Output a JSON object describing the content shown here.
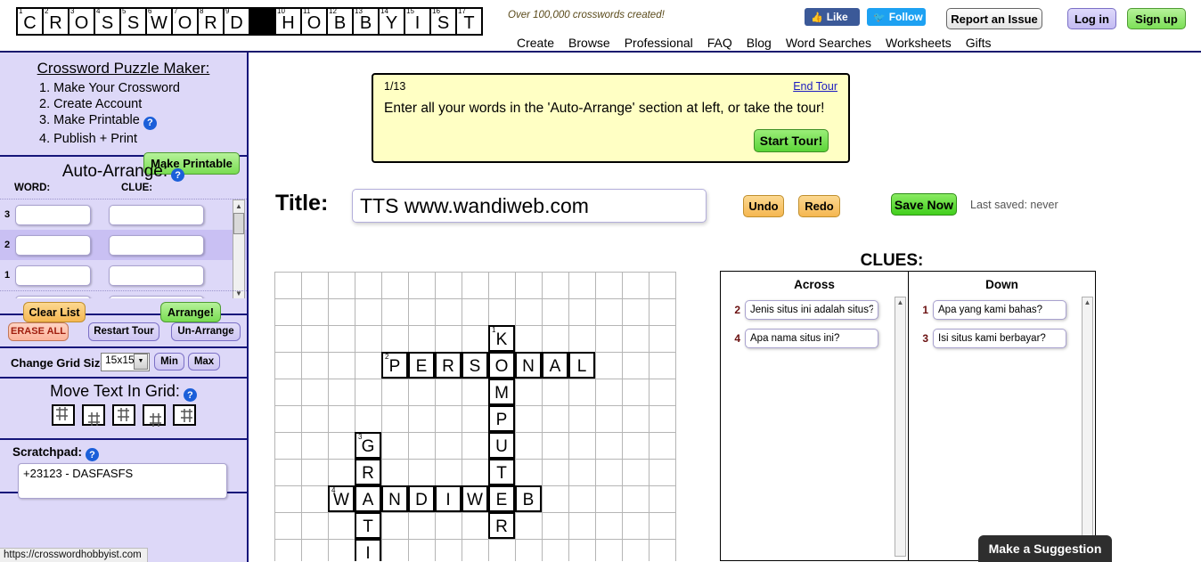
{
  "header": {
    "logo_letters": [
      {
        "n": "1",
        "l": "C"
      },
      {
        "n": "2",
        "l": "R"
      },
      {
        "n": "3",
        "l": "O"
      },
      {
        "n": "4",
        "l": "S"
      },
      {
        "n": "5",
        "l": "S"
      },
      {
        "n": "6",
        "l": "W"
      },
      {
        "n": "7",
        "l": "O"
      },
      {
        "n": "8",
        "l": "R"
      },
      {
        "n": "9",
        "l": "D"
      },
      {
        "n": "",
        "l": "",
        "black": true
      },
      {
        "n": "10",
        "l": "H"
      },
      {
        "n": "11",
        "l": "O"
      },
      {
        "n": "12",
        "l": "B"
      },
      {
        "n": "13",
        "l": "B"
      },
      {
        "n": "14",
        "l": "Y"
      },
      {
        "n": "15",
        "l": "I"
      },
      {
        "n": "16",
        "l": "S"
      },
      {
        "n": "17",
        "l": "T"
      }
    ],
    "tagline": "Over 100,000 crosswords created!",
    "facebook_label": "Like",
    "twitter_label": "Follow",
    "report_label": "Report an Issue",
    "login_label": "Log in",
    "signup_label": "Sign up",
    "nav": [
      "Create",
      "Browse",
      "Professional",
      "FAQ",
      "Blog",
      "Word Searches",
      "Worksheets",
      "Gifts"
    ]
  },
  "sidebar": {
    "maker_title": "Crossword Puzzle Maker:",
    "steps": [
      {
        "text": "1. Make Your Crossword",
        "help": false
      },
      {
        "text": "2. Create Account",
        "help": false
      },
      {
        "text": "3. Make Printable",
        "help": true
      },
      {
        "text": "4. Publish + Print",
        "help": false
      }
    ],
    "make_printable_label": "Make Printable",
    "auto_arrange_title": "Auto-Arrange:",
    "col_word": "WORD:",
    "col_clue": "CLUE:",
    "word_rows": [
      {
        "index": "1",
        "word": "",
        "clue": ""
      },
      {
        "index": "2",
        "word": "",
        "clue": ""
      },
      {
        "index": "3",
        "word": "",
        "clue": ""
      }
    ],
    "clear_list_label": "Clear List",
    "arrange_label": "Arrange!",
    "erase_all_label": "ERASE ALL",
    "restart_tour_label": "Restart Tour",
    "un_arrange_label": "Un-Arrange",
    "grid_size_label": "Change Grid Size:",
    "grid_size_value": "15x15",
    "min_label": "Min",
    "max_label": "Max",
    "move_text_title": "Move Text In Grid:",
    "scratchpad_label": "Scratchpad:",
    "scratchpad_value": "+23123 - DASFASFS",
    "status_url": "https://crosswordhobbyist.com"
  },
  "tour": {
    "counter": "1/13",
    "end_label": "End Tour",
    "message": "Enter all your words in the 'Auto-Arrange' section at left, or take the tour!",
    "start_label": "Start Tour!"
  },
  "toolbar": {
    "title_label": "Title:",
    "title_value": "TTS www.wandiweb.com",
    "undo_label": "Undo",
    "redo_label": "Redo",
    "save_label": "Save Now",
    "last_saved": "Last saved: never"
  },
  "grid": {
    "cols": 15,
    "rows": 11,
    "cell": 30,
    "filled": [
      {
        "r": 2,
        "c": 8,
        "l": "K",
        "n": "1"
      },
      {
        "r": 3,
        "c": 4,
        "l": "P",
        "n": "2"
      },
      {
        "r": 3,
        "c": 5,
        "l": "E",
        "n": ""
      },
      {
        "r": 3,
        "c": 6,
        "l": "R",
        "n": ""
      },
      {
        "r": 3,
        "c": 7,
        "l": "S",
        "n": ""
      },
      {
        "r": 3,
        "c": 8,
        "l": "O",
        "n": ""
      },
      {
        "r": 3,
        "c": 9,
        "l": "N",
        "n": ""
      },
      {
        "r": 3,
        "c": 10,
        "l": "A",
        "n": ""
      },
      {
        "r": 3,
        "c": 11,
        "l": "L",
        "n": ""
      },
      {
        "r": 4,
        "c": 8,
        "l": "M",
        "n": ""
      },
      {
        "r": 5,
        "c": 8,
        "l": "P",
        "n": ""
      },
      {
        "r": 6,
        "c": 3,
        "l": "G",
        "n": "3"
      },
      {
        "r": 6,
        "c": 8,
        "l": "U",
        "n": ""
      },
      {
        "r": 7,
        "c": 3,
        "l": "R",
        "n": ""
      },
      {
        "r": 7,
        "c": 8,
        "l": "T",
        "n": ""
      },
      {
        "r": 8,
        "c": 2,
        "l": "W",
        "n": "4"
      },
      {
        "r": 8,
        "c": 3,
        "l": "A",
        "n": ""
      },
      {
        "r": 8,
        "c": 4,
        "l": "N",
        "n": ""
      },
      {
        "r": 8,
        "c": 5,
        "l": "D",
        "n": ""
      },
      {
        "r": 8,
        "c": 6,
        "l": "I",
        "n": ""
      },
      {
        "r": 8,
        "c": 7,
        "l": "W",
        "n": ""
      },
      {
        "r": 8,
        "c": 8,
        "l": "E",
        "n": ""
      },
      {
        "r": 8,
        "c": 9,
        "l": "B",
        "n": ""
      },
      {
        "r": 9,
        "c": 3,
        "l": "T",
        "n": ""
      },
      {
        "r": 9,
        "c": 8,
        "l": "R",
        "n": ""
      },
      {
        "r": 10,
        "c": 3,
        "l": "I",
        "n": ""
      }
    ]
  },
  "clues": {
    "title": "CLUES:",
    "across_header": "Across",
    "down_header": "Down",
    "across": [
      {
        "num": "2",
        "text": "Jenis situs ini adalah situs?"
      },
      {
        "num": "4",
        "text": "Apa nama situs ini?"
      }
    ],
    "down": [
      {
        "num": "1",
        "text": "Apa yang kami bahas?"
      },
      {
        "num": "3",
        "text": "Isi situs kami berbayar?"
      }
    ]
  },
  "suggestion_tab": "Make a Suggestion"
}
